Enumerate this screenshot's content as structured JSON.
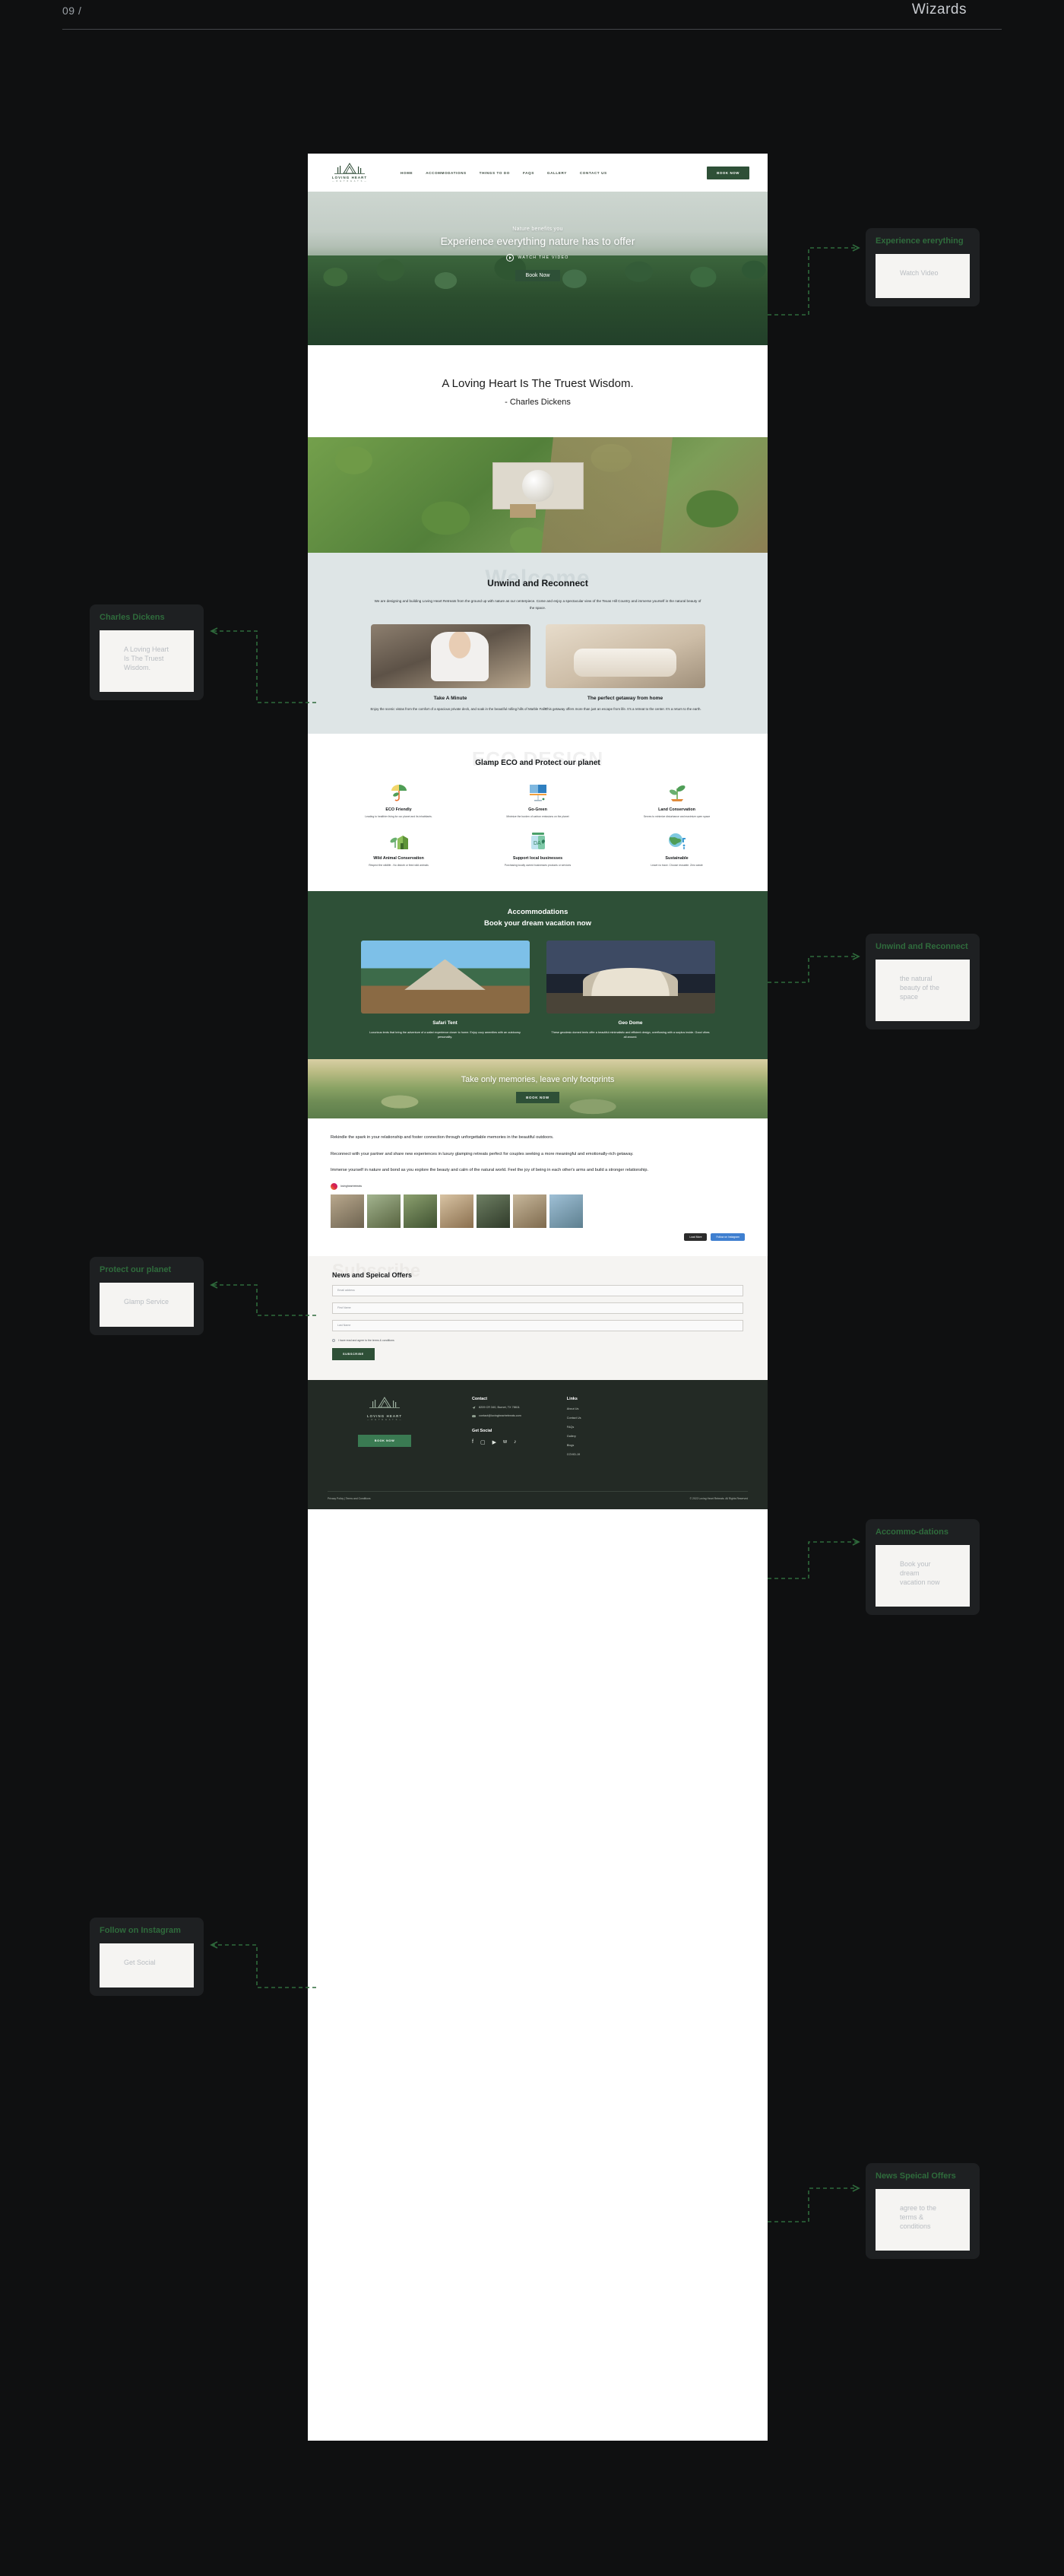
{
  "topbar": {
    "page_number": "09 /",
    "brand": "Wizards"
  },
  "site": {
    "nav": {
      "logo_name": "LOVING HEART",
      "logo_sub": "— R E T R E A T S —",
      "items": [
        "HOME",
        "ACCOMMODATIONS",
        "THINGS TO DO",
        "FAQS",
        "GALLERY",
        "CONTACT US"
      ],
      "cta": "BOOK NOW"
    },
    "hero": {
      "eyebrow": "Nature benefits you",
      "headline": "Experience everything nature has to offer",
      "watch_label": "WATCH THE VIDEO",
      "cta": "Book Now"
    },
    "quote": {
      "text": "A Loving Heart Is The Truest Wisdom.",
      "author": "- Charles Dickens"
    },
    "welcome": {
      "ghost": "Welcome",
      "heading": "Unwind and Reconnect",
      "body": "We are designing and building Loving Heart Retreats from the ground up with nature as our centerpiece. Come and enjoy a spectacular view of the Texas Hill Country and immerse yourself in the natural beauty of the space.",
      "cards": [
        {
          "title": "Take A Minute",
          "body": "Enjoy the scenic vistas from the comfort of a spacious private deck, and soak in the beautiful rolling hills of Marble Falls."
        },
        {
          "title": "The perfect getaway from home",
          "body": "This getaway offers more than just an escape from life. It's a retreat to the center. It's a return to the earth."
        }
      ]
    },
    "eco": {
      "ghost": "ECO DESIGN",
      "heading": "Glamp ECO and Protect our planet",
      "items": [
        {
          "icon": "umbrella-leaf-icon",
          "title": "ECO Friendly",
          "desc": "Leading to healthier living for our planet and its inhabitants."
        },
        {
          "icon": "solar-panel-icon",
          "title": "Go-Green",
          "desc": "Minimize the burden of carbon emissions on the planet"
        },
        {
          "icon": "sprout-icon",
          "title": "Land Conservation",
          "desc": "Serves to minimize disturbance and maximize open space"
        },
        {
          "icon": "house-plant-icon",
          "title": "Wild Animal Conservation",
          "desc": "Respect the wildlife - No disturb or feed wild animals"
        },
        {
          "icon": "jar-icon",
          "title": "Support local businesses",
          "desc": "Purchasing locally owned businesses products or services"
        },
        {
          "icon": "globe-tap-icon",
          "title": "Sustainable",
          "desc": "Leave no trace. Choose reusable. Zero waste"
        }
      ]
    },
    "accommodations": {
      "heading": "Accommodations",
      "subheading": "Book your dream vacation now",
      "items": [
        {
          "name": "Safari Tent",
          "desc": "Luxurious tents that bring the adventure of a safari experience closer to home. Enjoy cozy amenities with an outdoorsy personality."
        },
        {
          "name": "Geo Dome",
          "desc": "These geodesic domed tents offer a beautiful minimalistic and efficient design, overflowing with a surplus inside. Good vibes all around."
        }
      ]
    },
    "footprints": {
      "headline": "Take only memories, leave only footprints",
      "cta": "BOOK NOW"
    },
    "couples": {
      "paragraphs": [
        "Rekindle the spark in your relationship and foster connection through unforgettable memories in the beautiful outdoors.",
        "Reconnect with your partner and share new experiences in luxury glamping retreats perfect for couples seeking a more meaningful and emotionally-rich getaway.",
        "Immerse yourself in nature and bond as you explore the beauty and calm of the natural world. Feel the joy of being in each other's arms and build a stronger relationship."
      ],
      "instagram_handle": "lovingheartretreats",
      "buttons": [
        "Load More",
        "Follow on Instagram"
      ]
    },
    "subscribe": {
      "ghost": "Subscribe",
      "heading": "News and Speical Offers",
      "fields": [
        {
          "name": "email",
          "placeholder": "Email address",
          "value": ""
        },
        {
          "name": "first_name",
          "placeholder": "First Name",
          "value": ""
        },
        {
          "name": "last_name",
          "placeholder": "Last Name",
          "value": ""
        }
      ],
      "consent": "I have read and agree to the terms & conditions",
      "cta": "SUBSCRIBE"
    },
    "footer": {
      "logo_name": "LOVING HEART",
      "logo_sub": "— R E T R E A T S —",
      "cta": "BOOK NOW",
      "contact_title": "Contact",
      "address": "8209 CR 340, Burnet, TX 78611",
      "email": "contact@lovingheartretreats.com",
      "social_title": "Get Social",
      "social": [
        "facebook-icon",
        "instagram-icon",
        "youtube-icon",
        "twitter-icon",
        "tiktok-icon"
      ],
      "links_title": "Links",
      "links": [
        "About Us",
        "Contact Us",
        "FAQs",
        "Gallery",
        "Blogs",
        "COVID-19"
      ],
      "legal": "Privacy Policy | Terms and Conditions",
      "copyright": "© 2022 Loving Heart Retreats. All Rights Reserved"
    }
  },
  "annotations": [
    {
      "title": "Experience ererything",
      "sub": "Watch Video"
    },
    {
      "title": "Charles Dickens",
      "sub": "A Loving Heart Is The Truest Wisdom."
    },
    {
      "title": "Unwind and Reconnect",
      "sub": "the natural beauty of the space"
    },
    {
      "title": "Protect our planet",
      "sub": "Glamp Service"
    },
    {
      "title": "Accommo-dations",
      "sub": "Book your dream vacation now"
    },
    {
      "title": "Follow on Instagram",
      "sub": "Get Social"
    },
    {
      "title": "News Speical Offers",
      "sub": "agree to the terms & conditions"
    }
  ],
  "colors": {
    "brand_green": "#2e5037",
    "accent_green": "#2f6b3c",
    "page_bg": "#0f1011",
    "card_bg": "#1e2022"
  }
}
